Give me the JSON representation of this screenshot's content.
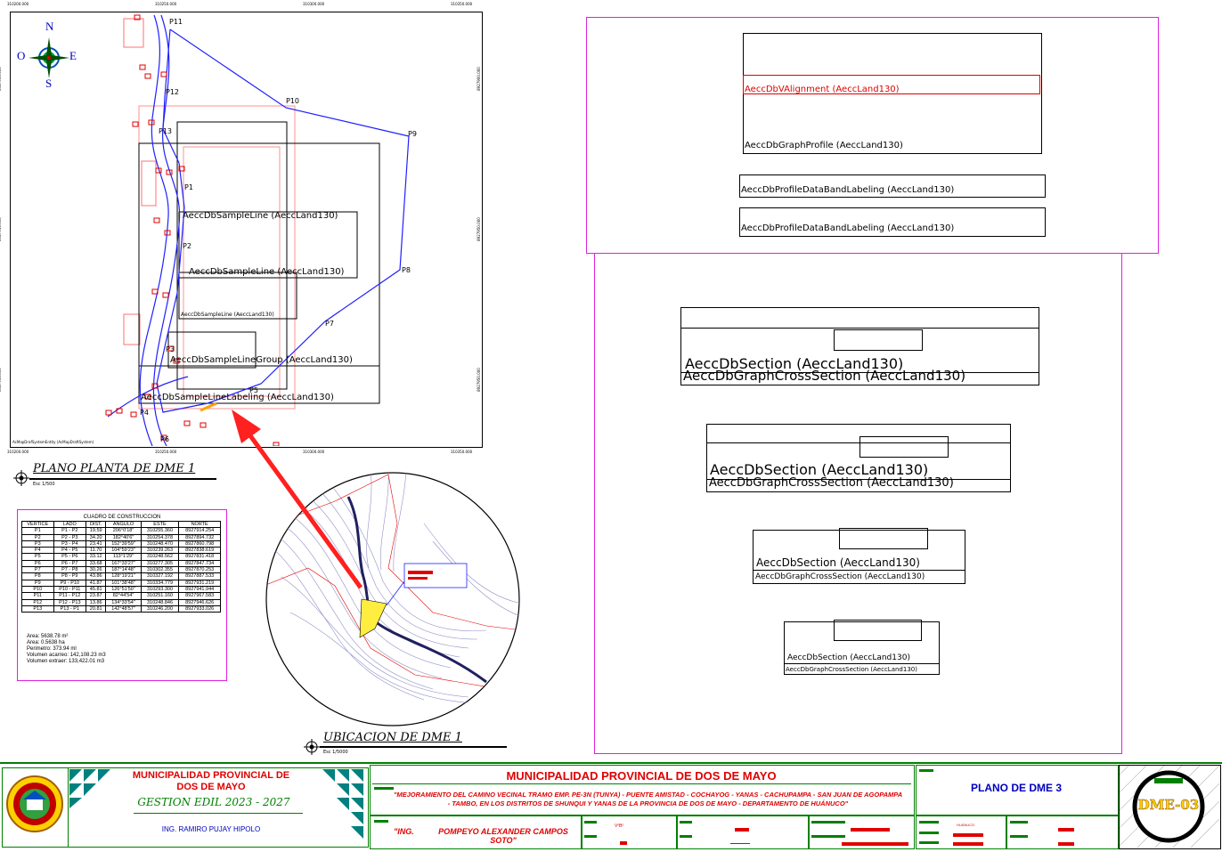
{
  "plan": {
    "coords_top": [
      "310200.000",
      "310250.000",
      "310300.000",
      "310350.000"
    ],
    "coords_bottom": [
      "310200.000",
      "310250.000",
      "310300.000",
      "310350.000"
    ],
    "coords_left": [
      "8927900.000",
      "8927950.000",
      "8927950.000"
    ],
    "compass": {
      "n": "N",
      "s": "S",
      "e": "E",
      "w": "O"
    },
    "points": [
      "P11",
      "P12",
      "P10",
      "P13",
      "P9",
      "P1",
      "P2",
      "P8",
      "P7",
      "P3",
      "P5",
      "P4",
      "P6"
    ],
    "labels": {
      "sample_line_1": "AeccDbSampleLine (AeccLand130)",
      "sample_line_2": "AeccDbSampleLine (AeccLand130)",
      "sample_line_3": "AeccDbSampleLine (AeccLand130)",
      "sample_line_group": "AeccDbSampleLineGroup (AeccLand130)",
      "sample_labeling": "AeccDbSampleLineLabeling (AeccLand130)",
      "map_entity": "AcMapDrafSystemEntity (AcMapDraftSystem)"
    },
    "title": "PLANO PLANTA DE DME 1",
    "scale": "Esc 1/500"
  },
  "construction_table": {
    "title": "CUADRO DE CONSTRUCCION",
    "headers": [
      "VERTICE",
      "LADO",
      "DIST.",
      "ANGULO",
      "ESTE",
      "NORTE"
    ],
    "rows": [
      [
        "P1",
        "P1 - P2",
        "19.59",
        "206°0'18\"",
        "310255.360",
        "8927914.254"
      ],
      [
        "P2",
        "P2 - P3",
        "34.20",
        "182°40'6\"",
        "310254.378",
        "8927894.732"
      ],
      [
        "P3",
        "P3 - P4",
        "23.41",
        "152°39'59\"",
        "310248.470",
        "8927860.798"
      ],
      [
        "P4",
        "P4 - P5",
        "11.70",
        "104°59'23\"",
        "310239.263",
        "8927838.619"
      ],
      [
        "P5",
        "P5 - P6",
        "33.12",
        "113°1'29\"",
        "310248.562",
        "8927831.418"
      ],
      [
        "P6",
        "P6 - P7",
        "33.68",
        "167°33'27\"",
        "310277.305",
        "8927847.734"
      ],
      [
        "P7",
        "P7 - P8",
        "30.26",
        "187°14'48\"",
        "310302.355",
        "8927870.253"
      ],
      [
        "P8",
        "P8 - P9",
        "43.86",
        "128°19'21\"",
        "310327.192",
        "8927887.533"
      ],
      [
        "P9",
        "P9 - P10",
        "41.87",
        "101°38'48\"",
        "310334.779",
        "8927931.219"
      ],
      [
        "P10",
        "P10 - P11",
        "45.81",
        "126°51'50\"",
        "310293.300",
        "8927941.944"
      ],
      [
        "P11",
        "P11 - P12",
        "23.87",
        "82°44'54\"",
        "310251.160",
        "8927967.583"
      ],
      [
        "P12",
        "P12 - P13",
        "13.86",
        "134°33'54\"",
        "310248.846",
        "8927946.626"
      ],
      [
        "P13",
        "P13 - P1",
        "20.81",
        "142°48'57\"",
        "310246.200",
        "8927933.026"
      ]
    ],
    "summary": [
      "Area: 5638.78 m²",
      "Area: 0.5638 ha",
      "Perimetro: 373.94 ml",
      "Volumen acarreo: 142,108.23 m3",
      "Volumen extraer: 133,422.01 m3"
    ]
  },
  "location": {
    "title": "UBICACION DE DME 1",
    "scale": "Esc 1/5000"
  },
  "profile": {
    "alignment": "AeccDbVAlignment (AeccLand130)",
    "graph": "AeccDbGraphProfile (AeccLand130)",
    "band1": "AeccDbProfileDataBandLabeling (AeccLand130)",
    "band2": "AeccDbProfileDataBandLabeling (AeccLand130)"
  },
  "sections": [
    {
      "section": "AeccDbSection (AeccLand130)",
      "graph": "AeccDbGraphCrossSection (AeccLand130)"
    },
    {
      "section": "AeccDbSection (AeccLand130)",
      "graph": "AeccDbGraphCrossSection (AeccLand130)"
    },
    {
      "section": "AeccDbSection (AeccLand130)",
      "graph": "AeccDbGraphCrossSection (AeccLand130)"
    },
    {
      "section": "AeccDbSection (AeccLand130)",
      "graph": "AeccDbGraphCrossSection (AeccLand130)"
    }
  ],
  "title_block": {
    "org_left": "MUNICIPALIDAD PROVINCIAL DE DOS DE MAYO",
    "gestion": "GESTION EDIL 2023 - 2027",
    "mayor": "ING. RAMIRO PUJAY HIPOLO",
    "org_main": "MUNICIPALIDAD PROVINCIAL DE DOS DE MAYO",
    "project": "\"MEJORAMIENTO DEL CAMINO VECINAL TRAMO EMP. PE-3N (TUNYA) - PUENTE AMISTAD - COCHAYOG - YANAS - CACHUPAMPA - SAN JUAN DE AGOPAMPA - TAMBO, EN LOS DISTRITOS DE SHUNQUI Y YANAS DE LA PROVINCIA DE DOS DE MAYO - DEPARTAMENTO DE HUÁNUCO\"",
    "engineer_prefix": "\"ING.",
    "engineer": "POMPEYO ALEXANDER CAMPOS SOTO\"",
    "plan_title": "PLANO DE DME 3",
    "sheet": "DME-03",
    "small_field": "VºBº",
    "small_field_2": "HUÁNUCO"
  },
  "colors": {
    "accent_red": "#e00000",
    "magenta": "#e020e0",
    "blue": "#0000ff",
    "green": "#008000"
  }
}
